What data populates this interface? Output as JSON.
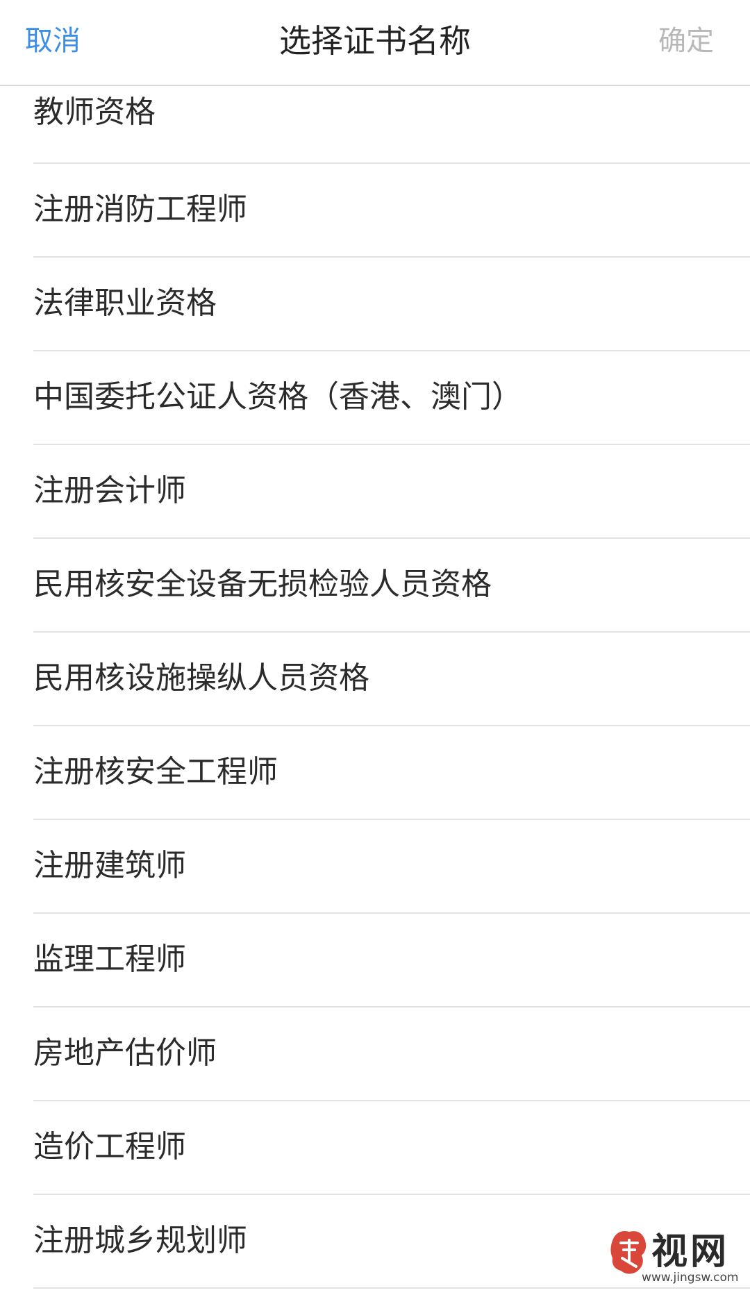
{
  "nav": {
    "cancel_label": "取消",
    "title": "选择证书名称",
    "confirm_label": "确定"
  },
  "certificates": [
    "教师资格",
    "注册消防工程师",
    "法律职业资格",
    "中国委托公证人资格（香港、澳门）",
    "注册会计师",
    "民用核安全设备无损检验人员资格",
    "民用核设施操纵人员资格",
    "注册核安全工程师",
    "注册建筑师",
    "监理工程师",
    "房地产估价师",
    "造价工程师",
    "注册城乡规划师"
  ],
  "watermark": {
    "text": "视网",
    "url": "www.jingsw.com"
  },
  "colors": {
    "accent": "#3a8ee6",
    "disabled": "#b8b8b8",
    "seal": "#d9473a"
  }
}
